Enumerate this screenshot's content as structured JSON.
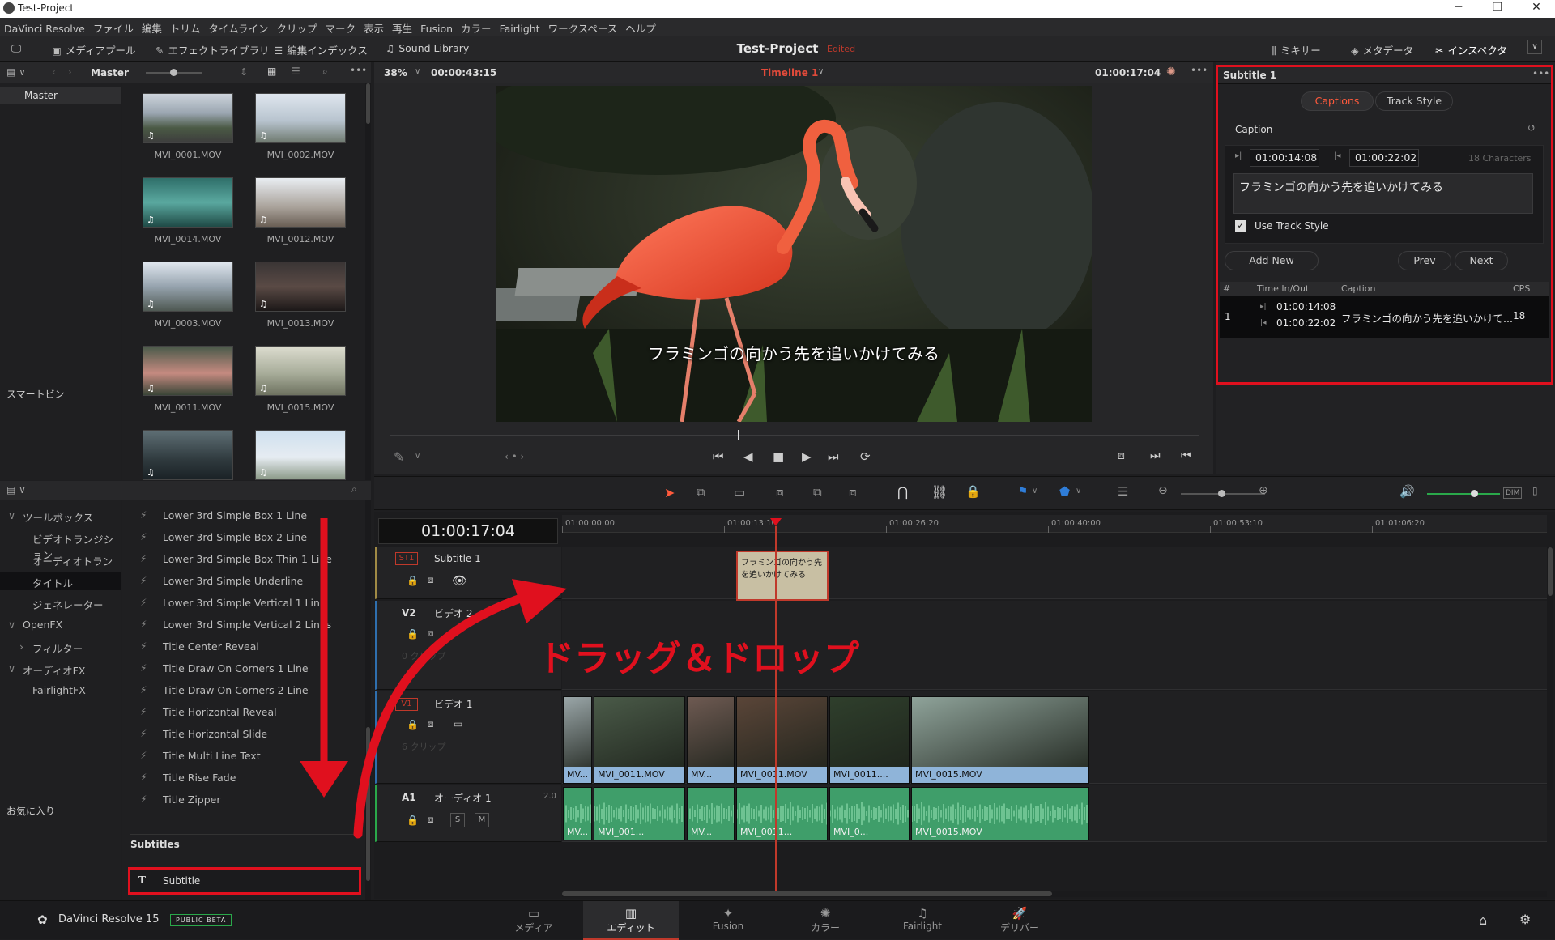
{
  "window": {
    "title": "Test-Project",
    "minimize": "─",
    "restore": "❐",
    "close": "✕"
  },
  "menu": [
    "DaVinci Resolve",
    "ファイル",
    "編集",
    "トリム",
    "タイムライン",
    "クリップ",
    "マーク",
    "表示",
    "再生",
    "Fusion",
    "カラー",
    "Fairlight",
    "ワークスペース",
    "ヘルプ"
  ],
  "toolbar": {
    "media_pool": "メディアプール",
    "effects_library": "エフェクトライブラリ",
    "edit_index": "編集インデックス",
    "sound_library": "Sound Library",
    "project_title": "Test-Project",
    "project_status": "Edited",
    "mixer": "ミキサー",
    "metadata": "メタデータ",
    "inspector": "インスペクタ"
  },
  "media_pool": {
    "bin_title": "Master",
    "master": "Master",
    "smart_bins": "スマートビン",
    "clips": [
      {
        "name": "MVI_0001.MOV",
        "scene": "mountain"
      },
      {
        "name": "MVI_0002.MOV",
        "scene": "building"
      },
      {
        "name": "MVI_0014.MOV",
        "scene": "aquarium"
      },
      {
        "name": "MVI_0012.MOV",
        "scene": "trees"
      },
      {
        "name": "MVI_0003.MOV",
        "scene": "entrance"
      },
      {
        "name": "MVI_0013.MOV",
        "scene": "dark"
      },
      {
        "name": "MVI_0011.MOV",
        "scene": "flamingos"
      },
      {
        "name": "MVI_0015.MOV",
        "scene": "croc"
      },
      {
        "name": "",
        "scene": "people"
      },
      {
        "name": "",
        "scene": "sky"
      }
    ]
  },
  "effects": {
    "tree": [
      {
        "label": "ツールボックス",
        "arrow": "∨"
      },
      {
        "label": "ビデオトランジション",
        "arrow": ""
      },
      {
        "label": "オーディオトランジ...",
        "arrow": ""
      },
      {
        "label": "タイトル",
        "arrow": ""
      },
      {
        "label": "ジェネレーター",
        "arrow": ""
      },
      {
        "label": "OpenFX",
        "arrow": "∨"
      },
      {
        "label": "フィルター",
        "arrow": "›"
      },
      {
        "label": "オーディオFX",
        "arrow": "∨"
      },
      {
        "label": "FairlightFX",
        "arrow": ""
      }
    ],
    "favorites": "お気に入り",
    "titles": [
      "Lower 3rd Simple Box 1 Line",
      "Lower 3rd Simple Box 2 Line",
      "Lower 3rd Simple Box Thin 1 Line",
      "Lower 3rd Simple Underline",
      "Lower 3rd Simple Vertical 1 Line",
      "Lower 3rd Simple Vertical 2 Lines",
      "Title Center Reveal",
      "Title Draw On Corners 1 Line",
      "Title Draw On Corners 2 Line",
      "Title Horizontal Reveal",
      "Title Horizontal Slide",
      "Title Multi Line Text",
      "Title Rise Fade",
      "Title Zipper"
    ],
    "subtitles_header": "Subtitles",
    "subtitle_item": "Subtitle"
  },
  "viewer": {
    "zoom": "38%",
    "duration": "00:00:43:15",
    "timeline_name": "Timeline 1",
    "timecode": "01:00:17:04",
    "subtitle_text": "フラミンゴの向かう先を追いかけてみる",
    "progress": 0.43
  },
  "inspector": {
    "title": "Subtitle 1",
    "tab_captions": "Captions",
    "tab_track_style": "Track Style",
    "caption_label": "Caption",
    "in_tc": "01:00:14:08",
    "out_tc": "01:00:22:02",
    "char_count": "18 Characters",
    "caption_text": "フラミンゴの向かう先を追いかけてみる",
    "use_track_style": "Use Track Style",
    "add_new": "Add New",
    "prev": "Prev",
    "next": "Next",
    "table_headers": [
      "#",
      "Time In/Out",
      "Caption",
      "CPS"
    ],
    "row": {
      "num": "1",
      "in": "01:00:14:08",
      "out": "01:00:22:02",
      "caption": "フラミンゴの向かう先を追いかけて...",
      "cps": "18"
    }
  },
  "timeline": {
    "timecode": "01:00:17:04",
    "ruler": [
      "01:00:00:00",
      "01:00:13:10",
      "01:00:26:20",
      "01:00:40:00",
      "01:00:53:10",
      "01:01:06:20"
    ],
    "tracks": {
      "st1": {
        "tag": "ST1",
        "name": "Subtitle 1"
      },
      "v2": {
        "tag": "V2",
        "name": "ビデオ 2",
        "count": "0 クリップ"
      },
      "v1": {
        "tag": "V1",
        "name": "ビデオ 1",
        "count": "6 クリップ"
      },
      "a1": {
        "tag": "A1",
        "name": "オーディオ 1",
        "level": "2.0",
        "solo": "S",
        "mute": "M"
      }
    },
    "subtitle_clip": "フラミンゴの向かう先を追いかけてみる",
    "video_clips": [
      "MV...",
      "MVI_0011.MOV",
      "MV...",
      "MVI_0011.MOV",
      "MVI_0011....",
      "MVI_0015.MOV"
    ],
    "audio_clips": [
      "MV...",
      "MVI_001...",
      "MV...",
      "MVI_0011...",
      "MVI_0...",
      "MVI_0015.MOV"
    ]
  },
  "annotation": {
    "text": "ドラッグ＆ドロップ",
    "color": "#e0101e"
  },
  "footer": {
    "app_name": "DaVinci Resolve 15",
    "badge": "PUBLIC BETA",
    "pages": [
      "メディア",
      "エディット",
      "Fusion",
      "カラー",
      "Fairlight",
      "デリバー"
    ],
    "active_page": "エディット"
  },
  "colors": {
    "accent_red": "#e0101e",
    "clip_blue": "#8fb4d9",
    "audio_green": "#3f9e6a",
    "subtitle_clip": "#c8bfa3"
  }
}
